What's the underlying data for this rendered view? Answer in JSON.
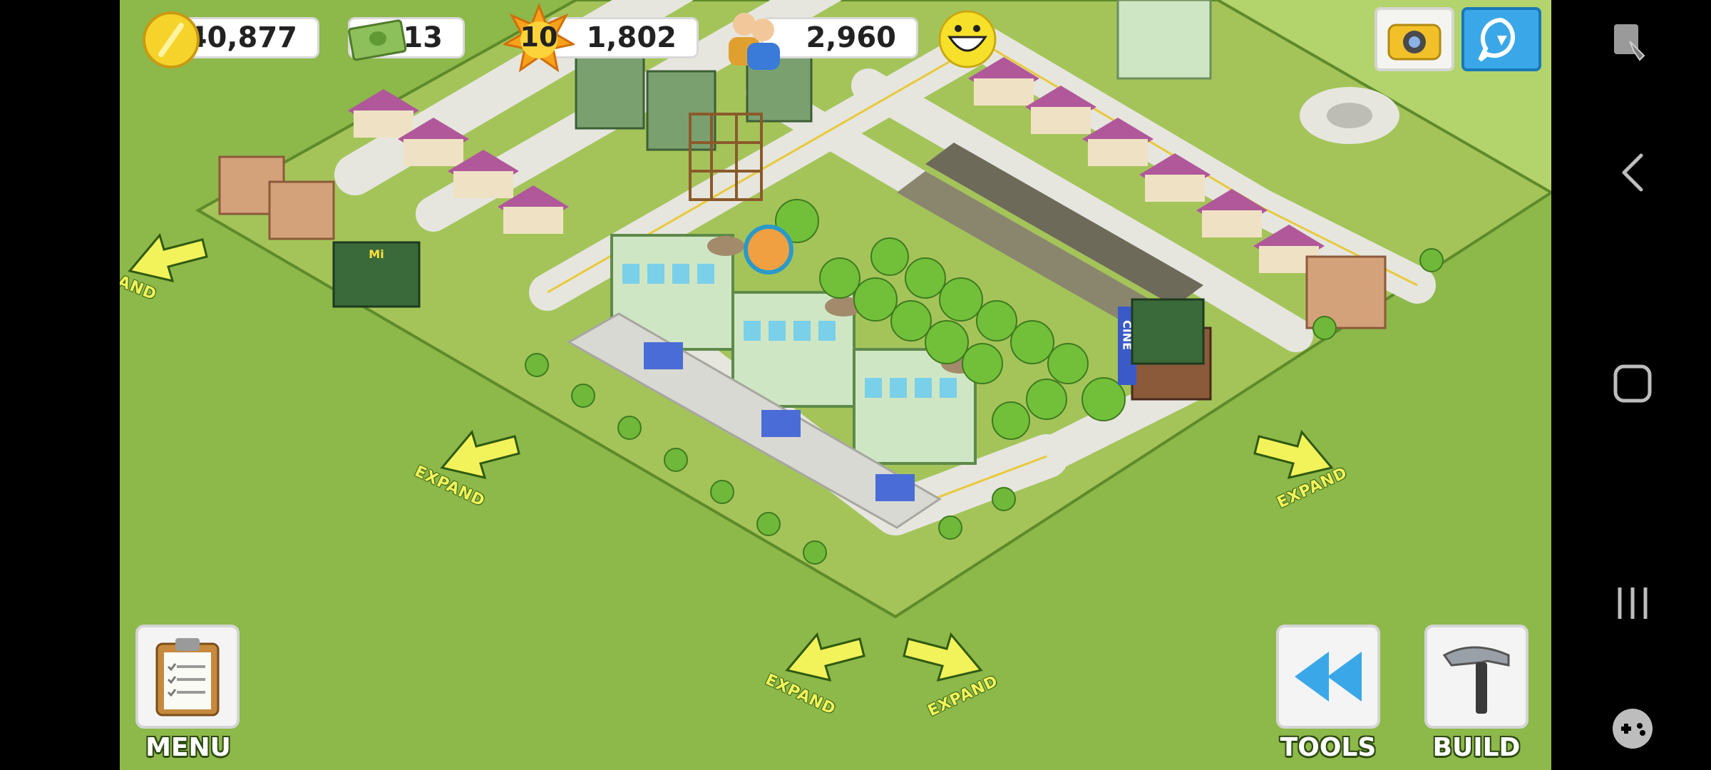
{
  "hud": {
    "coins": "40,877",
    "cash": "13",
    "level": "10",
    "xp": "1,802",
    "population": "2,960"
  },
  "expand_label": "EXPAND",
  "expand_label_partial": "AND",
  "buttons": {
    "menu": "MENU",
    "tools": "TOOLS",
    "build": "BUILD"
  },
  "signs": {
    "cinema": "CINE",
    "shop": "Mi"
  },
  "icons": {
    "coins": "coin-icon",
    "cash": "cash-icon",
    "level": "star-level-icon",
    "population": "population-icon",
    "happiness": "smiley-icon",
    "camera": "camera-icon",
    "share": "share-icon",
    "menu": "clipboard-icon",
    "tools": "rewind-icon",
    "build": "hammer-icon"
  },
  "colors": {
    "grass": "#8db84a",
    "road": "#e8e8e2",
    "expand_arrow": "#f2f25a",
    "roof_pink": "#b0589a",
    "building_green": "#cfe6c4"
  }
}
